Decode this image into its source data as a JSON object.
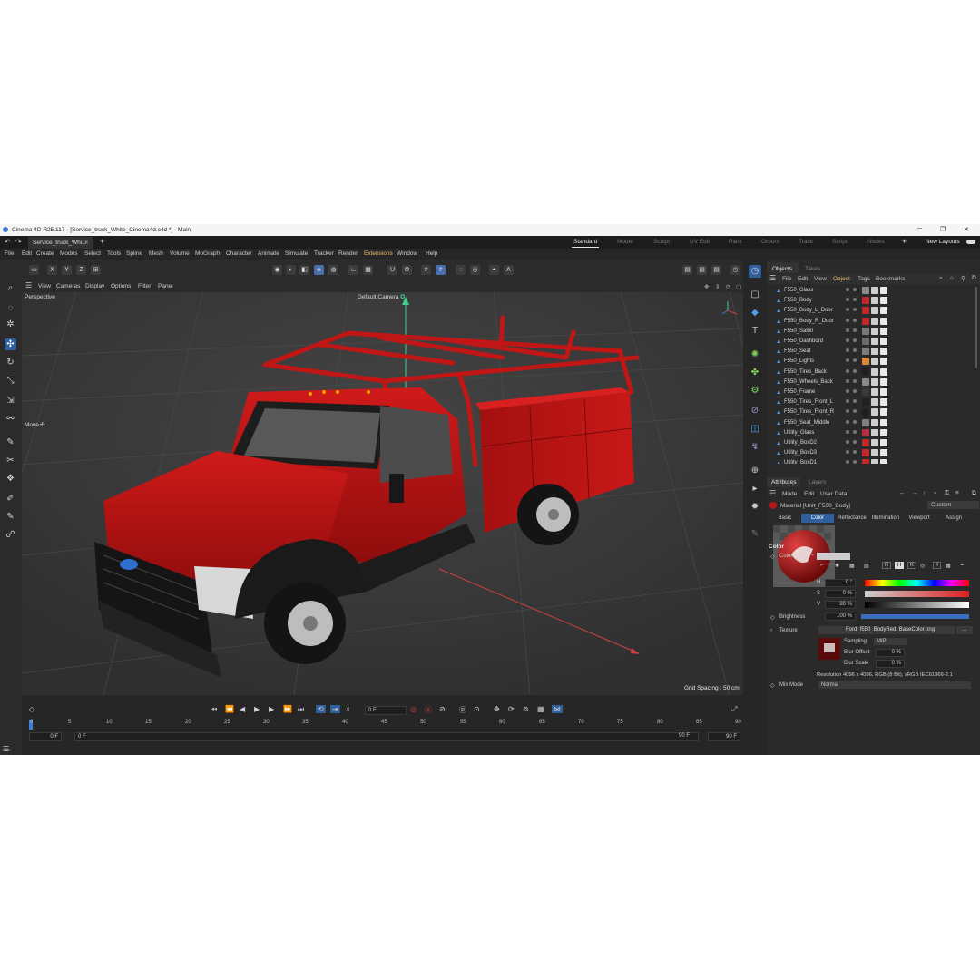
{
  "window": {
    "title": "Cinema 4D R25.117 - [Service_truck_White_Cinema4d.c4d *] - Main",
    "minimize": "─",
    "maximize": "❐",
    "close": "✕"
  },
  "doc_tab": {
    "label": "Service_truck_Whi...",
    "close": "✕",
    "add": "+"
  },
  "layouts": [
    "Standard",
    "Model",
    "Sculpt",
    "UV Edit",
    "Paint",
    "Groom",
    "Track",
    "Script",
    "Nodes"
  ],
  "layout_add": "+",
  "new_layouts": "New Layouts",
  "menu": [
    "File",
    "Edit",
    "Create",
    "Modes",
    "Select",
    "Tools",
    "Spline",
    "Mesh",
    "Volume",
    "MoGraph",
    "Character",
    "Animate",
    "Simulate",
    "Tracker",
    "Render",
    "Extensions",
    "Window",
    "Help"
  ],
  "toolbar": {
    "x": "X",
    "y": "Y",
    "z": "Z"
  },
  "viewport_menu": [
    "View",
    "Cameras",
    "Display",
    "Options",
    "Filter",
    "Panel"
  ],
  "viewport": {
    "name": "Perspective",
    "camera": "Default Camera",
    "camera_icon": "✪",
    "tool": "Move",
    "tool_icon": "✣",
    "grid_spacing": "Grid Spacing : 50 cm"
  },
  "timeline": {
    "current_frame": "0 F",
    "start_field": "0 F",
    "start_field2": "0 F",
    "end_field": "90 F",
    "end_field2": "90 F",
    "ruler": [
      "0",
      "5",
      "10",
      "15",
      "20",
      "25",
      "30",
      "35",
      "40",
      "45",
      "50",
      "55",
      "60",
      "65",
      "70",
      "75",
      "80",
      "85",
      "90"
    ]
  },
  "objects_panel": {
    "tabs": [
      "Objects",
      "Takes"
    ],
    "menu": [
      "File",
      "Edit",
      "View",
      "Object",
      "Tags",
      "Bookmarks"
    ],
    "items": [
      "F550_Glass",
      "F550_Body",
      "F550_Body_L_Door",
      "F550_Body_R_Door",
      "F550_Salon",
      "F550_Dashbord",
      "F550_Seat",
      "F550_Lights",
      "F550_Tires_Back",
      "F550_Wheels_Back",
      "F550_Frame",
      "F550_Tires_Front_L",
      "F550_Tires_Front_R",
      "F550_Seat_Middle",
      "Utility_Glass",
      "Utility_BoxD2",
      "Utility_BoxD3",
      "Utility_BoxD1"
    ],
    "colors": {
      "tags": [
        "#8a8a8a",
        "#c0282a",
        "#c0282a",
        "#c0282a",
        "#7a7a7a",
        "#6a6a6a",
        "#7e7e7e",
        "#d88a3a",
        "#202020",
        "#8a8a8a",
        "#3a3a3a",
        "#202020",
        "#202020",
        "#7e7e7e",
        "#b03040",
        "#c0282a",
        "#c0282a",
        "#c0282a"
      ]
    }
  },
  "attributes_panel": {
    "tabs": [
      "Attributes",
      "Layers"
    ],
    "menu": [
      "Mode",
      "Edit",
      "User Data"
    ],
    "material": "Material [Unit_F550_Body]",
    "preset": "Custom",
    "channels": [
      "Basic",
      "Color",
      "Reflectance",
      "Illumination",
      "Viewport",
      "Assign"
    ],
    "section": "Color",
    "color_label": "Color",
    "h_label": "H",
    "h_value": "0 °",
    "s_label": "S",
    "s_value": "0 %",
    "v_label": "V",
    "v_value": "80 %",
    "brightness_label": "Brightness",
    "brightness_value": "100 %",
    "texture_label": "Texture",
    "texture_file": "Ford_f550_BodyRed_BaseColor.png",
    "texture_more": "...",
    "sampling_label": "Sampling",
    "sampling_value": "MIP",
    "blur_offset_label": "Blur Offset",
    "blur_offset_value": "0 %",
    "blur_scale_label": "Blur Scale",
    "blur_scale_value": "0 %",
    "resolution": "Resolution 4096 x 4096, RGB (8 Bit), sRGB IEC61966-2.1",
    "mix_mode_label": "Mix Mode",
    "mix_mode_value": "Normal",
    "color_modes": [
      "R",
      "H",
      "K",
      "#"
    ]
  },
  "colors": {
    "accent": "#2f5f9d",
    "truck_red": "#b81414",
    "bg": "#2e2e2e"
  }
}
